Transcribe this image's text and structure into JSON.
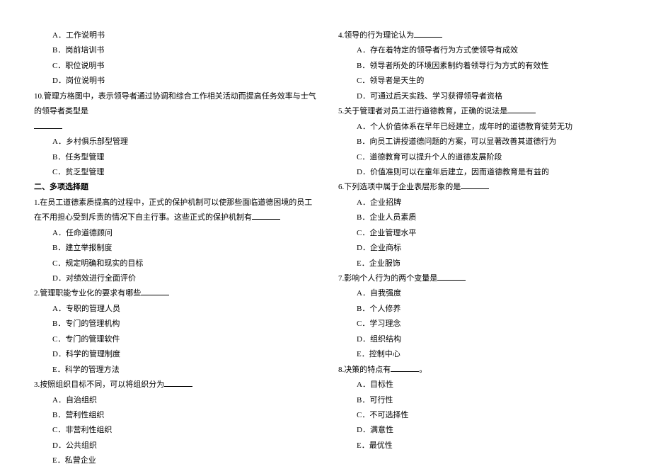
{
  "left": {
    "q9_options": {
      "a": "A．工作说明书",
      "b": "B．岗前培训书",
      "c": "C．职位说明书",
      "d": "D．岗位说明书"
    },
    "q10": {
      "stem": "10.管理方格图中，表示领导者通过协调和综合工作相关活动而提高任务效率与士气的领导者类型是",
      "a": "A．乡村俱乐部型管理",
      "b": "B．任务型管理",
      "c": "C．贫乏型管理"
    },
    "section2_title": "二、多项选择题",
    "mq1": {
      "stem_pre": "1.在员工道德素质提高的过程中，正式的保护机制可以使那些面临道德困境的员工在不用担心受到斥责的情况下自主行事。这些正式的保护机制有",
      "a": "A．任命道德顾问",
      "b": "B．建立举报制度",
      "c": "C．规定明确和现实的目标",
      "d": "D．对绩效进行全面评价"
    },
    "mq2": {
      "stem": "2.管理职能专业化的要求有哪些",
      "a": "A．专职的管理人员",
      "b": "B．专门的管理机构",
      "c": "C．专门的管理软件",
      "d": "D．科学的管理制度",
      "e": "E．科学的管理方法"
    },
    "mq3": {
      "stem": "3.按照组织目标不同，可以将组织分为",
      "a": "A．自治组织",
      "b": "B．营利性组织",
      "c": "C．非营利性组织",
      "d": "D．公共组织",
      "e": "E．私营企业"
    }
  },
  "right": {
    "mq4": {
      "stem": "4.领导的行为理论认为",
      "a": "A．存在着特定的领导者行为方式使领导有成效",
      "b": "B．领导者所处的环境因素制约着领导行为方式的有效性",
      "c": "C．领导者是天生的",
      "d": "D．可通过后天实践、学习获得领导者资格"
    },
    "mq5": {
      "stem": "5.关于管理者对员工进行道德教育，正确的说法是",
      "a": "A．个人价值体系在早年已经建立，成年时的道德教育徒劳无功",
      "b": "B．向员工讲授道德问题的方案，可以显著改善其道德行为",
      "c": "C．道德教育可以提升个人的道德发展阶段",
      "d": "D．价值准则可以在童年后建立，因而道德教育是有益的"
    },
    "mq6": {
      "stem": "6.下列选项中属于企业表层形象的是",
      "a": "A．企业招牌",
      "b": "B．企业人员素质",
      "c": "C．企业管理水平",
      "d": "D．企业商标",
      "e": "E．企业服饰"
    },
    "mq7": {
      "stem": "7.影响个人行为的两个变量是",
      "a": "A．自我强度",
      "b": "B．个人修养",
      "c": "C．学习理念",
      "d": "D．组织结构",
      "e": "E．控制中心"
    },
    "mq8": {
      "stem_pre": "8.决策的特点有",
      "stem_post": "。",
      "a": "A．目标性",
      "b": "B．可行性",
      "c": "C．不可选择性",
      "d": "D．满意性",
      "e": "E．最优性"
    }
  }
}
